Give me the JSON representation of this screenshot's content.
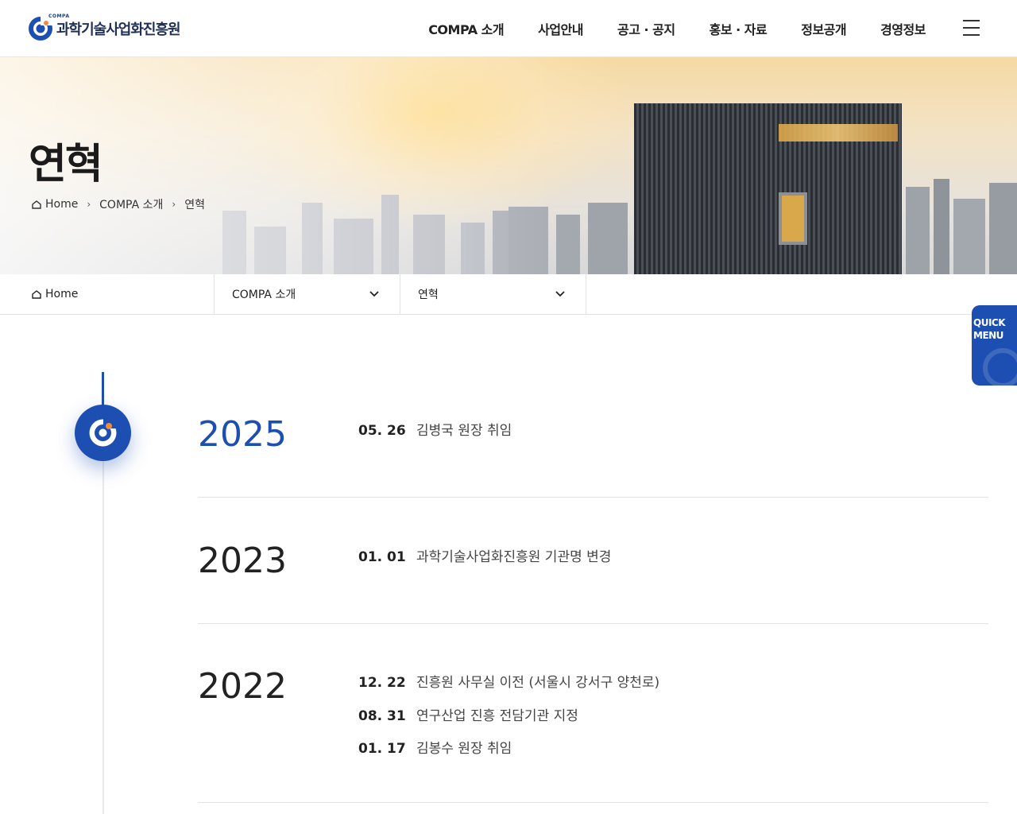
{
  "header": {
    "logo_small": "COMPA",
    "logo_text": "과학기술사업화진흥원",
    "nav": [
      "COMPA 소개",
      "사업안내",
      "공고 · 공지",
      "홍보 · 자료",
      "정보공개",
      "경영정보"
    ]
  },
  "hero": {
    "title": "연혁",
    "breadcrumb": [
      "Home",
      "COMPA 소개",
      "연혁"
    ]
  },
  "subnav": {
    "home": "Home",
    "level1": "COMPA 소개",
    "level2": "연혁"
  },
  "quick_menu": {
    "line1": "QUICK",
    "line2": "MENU"
  },
  "colors": {
    "brand_blue": "#1d4fb2",
    "accent_orange": "#f08a3c"
  },
  "timeline": [
    {
      "year": "2025",
      "events": [
        {
          "date": "05. 26",
          "text": "김병국 원장 취임"
        }
      ]
    },
    {
      "year": "2023",
      "events": [
        {
          "date": "01. 01",
          "text": "과학기술사업화진흥원 기관명 변경"
        }
      ]
    },
    {
      "year": "2022",
      "events": [
        {
          "date": "12. 22",
          "text": "진흥원 사무실 이전 (서울시 강서구 양천로)"
        },
        {
          "date": "08. 31",
          "text": "연구산업 진흥 전담기관 지정"
        },
        {
          "date": "01. 17",
          "text": "김봉수 원장 취임"
        }
      ]
    }
  ]
}
